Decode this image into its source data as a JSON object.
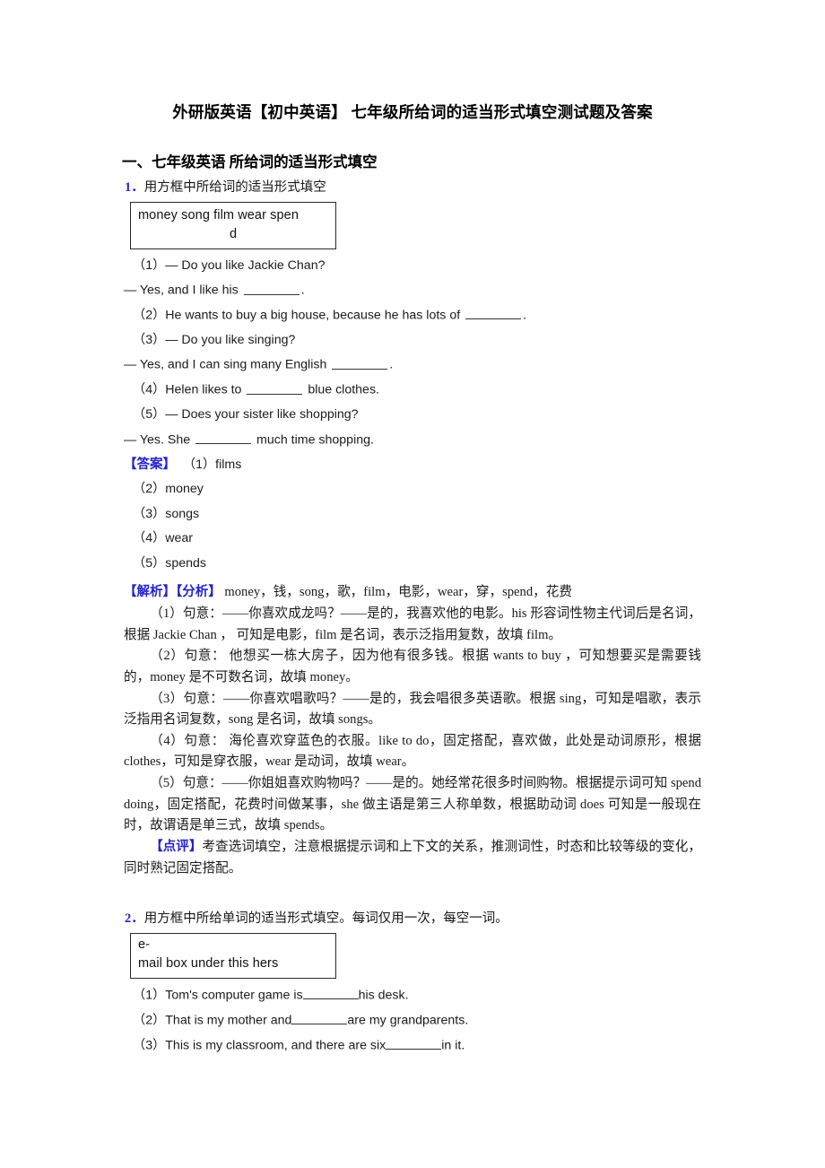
{
  "document": {
    "title": "外研版英语【初中英语】 七年级所给词的适当形式填空测试题及答案",
    "section_heading": "一、七年级英语 所给词的适当形式填空",
    "accent_color": "#2424c8",
    "text_color": "#1a1a1a"
  },
  "question1": {
    "number": "1．",
    "stem": "用方框中所给词的适当形式填空",
    "wordbox_line1": "money  song  film   wear  spen",
    "wordbox_line2": "d",
    "items": [
      {
        "label": "（1）",
        "text_before": "— Do you like Jackie Chan?",
        "has_blank": false
      },
      {
        "label": "",
        "text_before": "— Yes, and I like his ",
        "text_after": ".",
        "has_blank": true
      },
      {
        "label": "（2）",
        "text_before": "He wants to buy a big house, because he has lots of ",
        "text_after": ".",
        "has_blank": true
      },
      {
        "label": "（3）",
        "text_before": "— Do you like singing?",
        "has_blank": false
      },
      {
        "label": "",
        "text_before": "— Yes, and I can sing many English ",
        "text_after": ".",
        "has_blank": true
      },
      {
        "label": "（4）",
        "text_before": "Helen likes to ",
        "text_after": " blue clothes.",
        "has_blank": true
      },
      {
        "label": "（5）",
        "text_before": "— Does your sister like shopping?",
        "has_blank": false
      },
      {
        "label": "",
        "text_before": "— Yes. She ",
        "text_after": " much time shopping.",
        "has_blank": true
      }
    ],
    "answer_tag": "【答案】",
    "answers": [
      "（1）films",
      "（2）money",
      "（3）songs",
      "（4）wear",
      "（5）spends"
    ],
    "explain_tag": "【解析】",
    "analyze_tag": "【分析】",
    "analyze_head": " money，钱，song，歌，film，电影，wear，穿，spend，花费",
    "analysis_paragraphs": [
      "（1）句意：——你喜欢成龙吗？——是的，我喜欢他的电影。his 形容词性物主代词后是名词，根据 Jackie Chan ， 可知是电影，film 是名词，表示泛指用复数，故填 film。",
      "（2）句意： 他想买一栋大房子，因为他有很多钱。根据 wants to buy ，可知想要买是需要钱的，money 是不可数名词，故填 money。",
      "（3）句意：——你喜欢唱歌吗？——是的，我会唱很多英语歌。根据 sing，可知是唱歌，表示泛指用名词复数，song 是名词，故填 songs。",
      "（4）句意： 海伦喜欢穿蓝色的衣服。like to do，固定搭配，喜欢做，此处是动词原形，根据 clothes，可知是穿衣服，wear 是动词，故填 wear。",
      "（5）句意：——你姐姐喜欢购物吗？——是的。她经常花很多时间购物。根据提示词可知 spend doing，固定搭配，花费时间做某事，she 做主语是第三人称单数，根据助动词 does 可知是一般现在时，故谓语是单三式，故填 spends。"
    ],
    "comment_tag": "【点评】",
    "comment_text": "考查选词填空，注意根据提示词和上下文的关系，推测词性，时态和比较等级的变化，同时熟记固定搭配。"
  },
  "question2": {
    "number": "2．",
    "stem": "用方框中所给单词的适当形式填空。每词仅用一次，每空一词。",
    "wordbox_line1": "e-",
    "wordbox_line2": "mail  box  under    this   hers",
    "items": [
      {
        "label": "（1）",
        "text_before": "Tom's computer game is",
        "text_after": "his desk.",
        "has_blank": true
      },
      {
        "label": "（2）",
        "text_before": "That is my mother and",
        "text_after": "are my grandparents.",
        "has_blank": true
      },
      {
        "label": "（3）",
        "text_before": "This is my classroom, and there are six",
        "text_after": "in it.",
        "has_blank": true
      }
    ]
  }
}
